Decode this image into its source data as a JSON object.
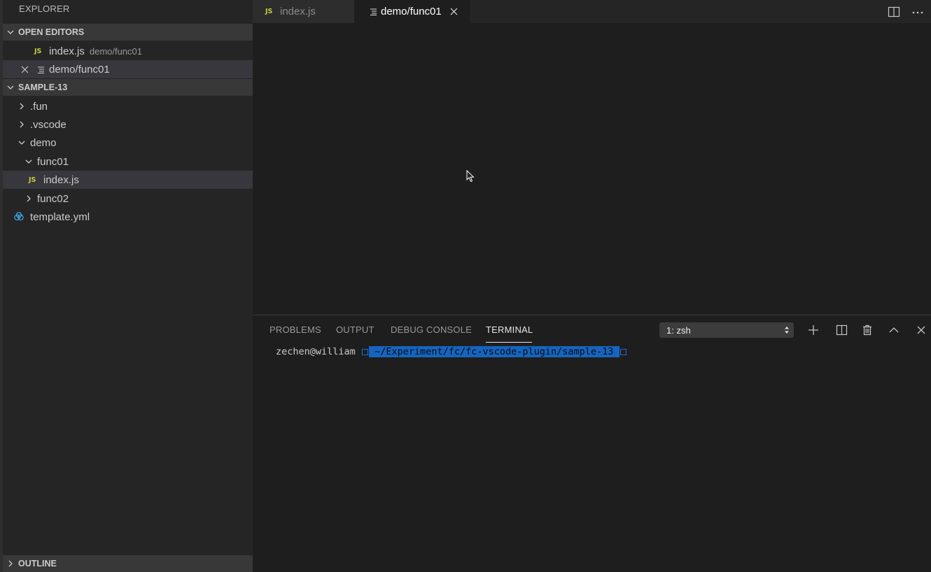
{
  "sidebar": {
    "title": "EXPLORER",
    "open_editors": {
      "header": "OPEN EDITORS",
      "items": [
        {
          "badge": "JS",
          "label": "index.js",
          "description": "demo/func01"
        },
        {
          "label": "demo/func01"
        }
      ]
    },
    "workspace": {
      "header": "SAMPLE-13",
      "items": [
        {
          "label": ".fun"
        },
        {
          "label": ".vscode"
        },
        {
          "label": "demo"
        },
        {
          "label": "func01"
        },
        {
          "badge": "JS",
          "label": "index.js"
        },
        {
          "label": "func02"
        },
        {
          "label": "template.yml"
        }
      ]
    },
    "outline": {
      "header": "OUTLINE"
    }
  },
  "tabs": [
    {
      "badge": "JS",
      "label": "index.js"
    },
    {
      "label": "demo/func01"
    }
  ],
  "panel": {
    "tabs": [
      "PROBLEMS",
      "OUTPUT",
      "DEBUG CONSOLE",
      "TERMINAL"
    ],
    "terminal_select": "1: zsh",
    "prompt_user": "zechen@william",
    "prompt_path": " ~/Experiment/fc/fc-vscode-plugin/sample-13 "
  },
  "colors": {
    "accent": "#1565c0",
    "js_badge": "#cbcb41",
    "yaml_icon": "#3fa7e0"
  }
}
